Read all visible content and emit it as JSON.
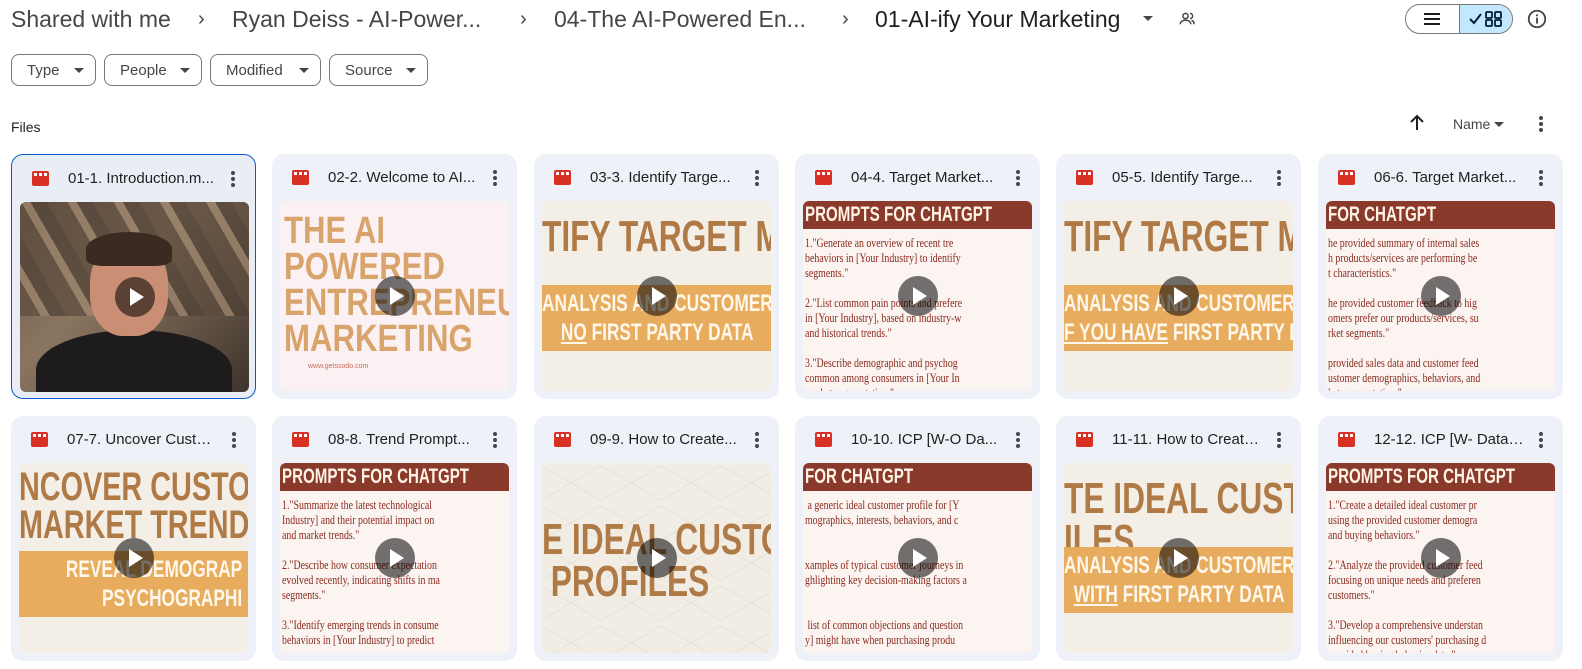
{
  "breadcrumb": {
    "items": [
      "Shared with me",
      "Ryan Deiss - AI-Power...",
      "04-The AI-Powered En...",
      "01-AI-ify Your Marketing"
    ]
  },
  "filters": [
    "Type",
    "People",
    "Modified",
    "Source"
  ],
  "section": {
    "label": "Files",
    "sort_label": "Name"
  },
  "colors": {
    "accent": "#0b57d0",
    "card_bg": "#eef1f7",
    "video_icon": "#d93025",
    "toggle_active": "#c2e7ff"
  },
  "files": [
    {
      "name": "01-1. Introduction.m...",
      "thumb_type": "person",
      "selected": true
    },
    {
      "name": "02-2. Welcome to AI...",
      "thumb_type": "title",
      "thumb_text": "THE AI POWERED ENTREPRENEUR: MARKETING",
      "thumb_url": "www.getssodo.com"
    },
    {
      "name": "03-3. Identify Targe...",
      "thumb_type": "banner",
      "thumb_line1": "TIFY TARGET MAR",
      "thumb_band1": "ANALYSIS AND CUSTOMER FE",
      "thumb_band2_under": "NO",
      "thumb_band2_rest": " FIRST PARTY DATA"
    },
    {
      "name": "04-4. Target Market...",
      "thumb_type": "prompt",
      "thumb_header": "PROMPTS FOR CHATGPT",
      "thumb_body": "1.\"Generate an overview of recent tre\nbehaviors in [Your Industry] to identify\nsegments.\"\n\n2.\"List common pain points and prefere\nin [Your Industry], based on industry-w\nand historical trends.\"\n\n3.\"Describe demographic and psychog\ncommon among consumers in [Your In\nmarket segmentation.\""
    },
    {
      "name": "05-5. Identify Targe...",
      "thumb_type": "banner",
      "thumb_line1": "TIFY TARGET MAR",
      "thumb_band1": "ANALYSIS AND CUSTOMER FE",
      "thumb_band2_under": "F YOU HAVE",
      "thumb_band2_rest": " FIRST PARTY DAT"
    },
    {
      "name": "06-6. Target Market...",
      "thumb_type": "prompt",
      "thumb_header": "FOR CHATGPT",
      "thumb_body": "he provided summary of internal sales\nh products/services are performing be\nt characteristics.\"\n\nhe provided customer feedback to hig\nomers prefer our products/services, su\nrket segments.\"\n\nprovided sales data and customer feed\nustomer demographics, behaviors, and\nket segmentation.\""
    },
    {
      "name": "07-7. Uncover Custo...",
      "thumb_type": "trend",
      "thumb_line1": "NCOVER CUSTON",
      "thumb_line2": "MARKET TRENDS",
      "thumb_band1": "REVEAL DEMOGRAP",
      "thumb_band2": "PSYCHOGRAPHI"
    },
    {
      "name": "08-8. Trend Prompt...",
      "thumb_type": "prompt",
      "thumb_header": "PROMPTS FOR CHATGPT",
      "thumb_body": "1.\"Summarize the latest technological\nIndustry] and their potential impact on\nand market trends.\"\n\n2.\"Describe how consumer expectation\nevolved recently, indicating shifts in ma\nsegments.\"\n\n3.\"Identify emerging trends in consume\nbehaviors in [Your Industry] to predict"
    },
    {
      "name": "09-9. How to Create...",
      "thumb_type": "profiles",
      "thumb_text": "E IDEAL CUSTOMI\n PROFILES"
    },
    {
      "name": "10-10. ICP [W-O Da...",
      "thumb_type": "prompt",
      "thumb_header": "FOR CHATGPT",
      "thumb_body": " a generic ideal customer profile for [Y\nmographics, interests, behaviors, and c\n\n\nxamples of typical customer journeys in\nghlighting key decision-making factors a\n\n\n list of common objections and question\ny] might have when purchasing produ"
    },
    {
      "name": "11-11. How to Create...",
      "thumb_type": "banner",
      "thumb_line1": "TE IDEAL CUSTOM",
      "thumb_line1b": "ILES",
      "thumb_band1": "ANALYSIS AND CUSTOMER FE",
      "thumb_band2_under": "WITH",
      "thumb_band2_rest": " FIRST PARTY DATA"
    },
    {
      "name": "12-12. ICP [W- Data]...",
      "thumb_type": "prompt",
      "thumb_header": "PROMPTS FOR CHATGPT",
      "thumb_body": "1.\"Create a detailed ideal customer pr\nusing the provided customer demogra\nand buying behaviors.\"\n\n2.\"Analyze the provided customer feed\nfocusing on unique needs and preferen\ncustomers.\"\n\n3.\"Develop a comprehensive understan\ninfluencing our customers' purchasing d\nprovided buying behavior data.\""
    }
  ]
}
